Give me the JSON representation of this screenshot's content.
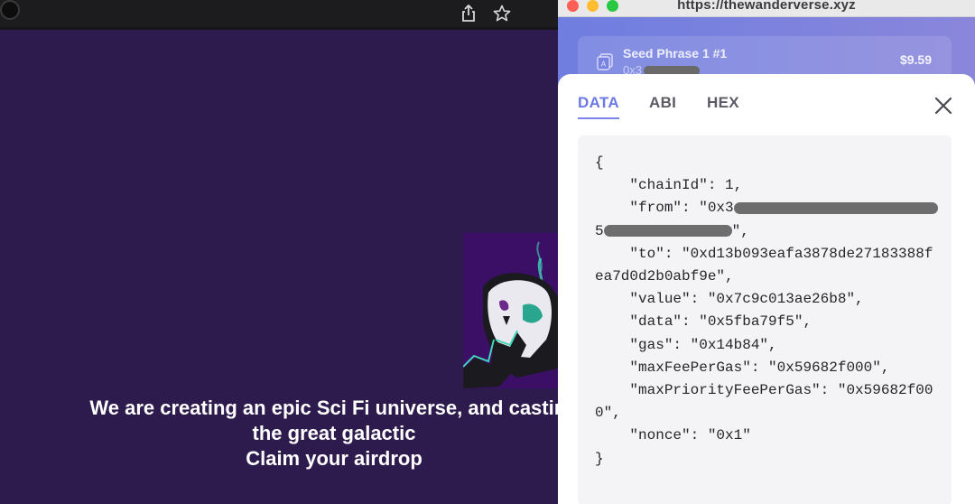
{
  "window": {
    "url": "https://thewanderverse.xyz"
  },
  "browser": {
    "share_icon": "share-icon",
    "star_icon": "star-icon",
    "extension_icon": "extension-icon"
  },
  "hero": {
    "line1": "We are creating an epic Sci Fi universe, and casting",
    "line2": "the great galactic",
    "line3": "Claim your airdrop"
  },
  "account": {
    "name": "Seed Phrase 1 #1",
    "address_prefix": "0x3",
    "balance": "$9.59"
  },
  "tabs": [
    {
      "label": "DATA",
      "active": true
    },
    {
      "label": "ABI",
      "active": false
    },
    {
      "label": "HEX",
      "active": false
    }
  ],
  "transaction": {
    "open_brace": "{",
    "close_brace": "}",
    "chainId_line": "    \"chainId\": 1,",
    "from_line1": "    \"from\": \"0x3",
    "from_line2_start": "5",
    "from_line2_end": "\",",
    "to_line1": "    \"to\": \"0xd13b093eafa3878de27183388f",
    "to_line2": "ea7d0d2b0abf9e\",",
    "value_line": "    \"value\": \"0x7c9c013ae26b8\",",
    "data_line": "    \"data\": \"0x5fba79f5\",",
    "gas_line": "    \"gas\": \"0x14b84\",",
    "maxFee_line": "    \"maxFeePerGas\": \"0x59682f000\",",
    "maxPriority_line1": "    \"maxPriorityFeePerGas\": \"0x59682f00",
    "maxPriority_line2": "0\",",
    "nonce_line": "    \"nonce\": \"0x1\""
  },
  "colors": {
    "accent": "#6b78e5",
    "page_bg": "#2d1b4d",
    "wallet_header": "#7b84df"
  }
}
